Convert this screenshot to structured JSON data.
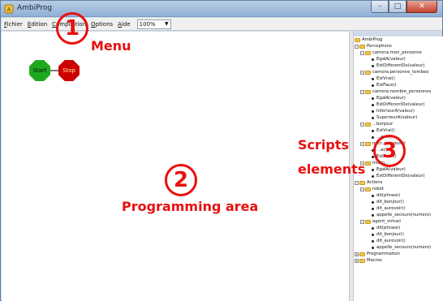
{
  "window": {
    "title": "AmbiProg",
    "minimize_glyph": "–",
    "maximize_glyph": "□",
    "close_glyph": "✕"
  },
  "menubar": {
    "items": [
      {
        "label": "Fichier",
        "underline": "F",
        "rest": "ichier"
      },
      {
        "label": "Edition",
        "underline": "E",
        "rest": "dition"
      },
      {
        "label": "Compilation",
        "underline": "C",
        "rest": "ompilation"
      },
      {
        "label": "Options",
        "underline": "O",
        "rest": "ptions"
      },
      {
        "label": "Aide",
        "underline": "A",
        "rest": "ide"
      }
    ],
    "zoom_value": "100%"
  },
  "program_area": {
    "start_label": "Start",
    "stop_label": "Stop"
  },
  "tree": {
    "root": "AmbiProg",
    "perceptions": "Perceptions",
    "camera_mon_personne": "camera.mon_personne",
    "egala_valeur_1": "EgalA(valeur)",
    "estdifferentde_valeur_1": "EstDifferentDe(valeur)",
    "camera_personne_tombee": "camera.personne_tombee",
    "estvrai_1": "EstVrai()",
    "estfaux_1": "EstFaux()",
    "camera_nombre_personnes": "camera.nombre_personnes",
    "egala_valeur_2": "EgalA(valeur)",
    "estdifferentde_valeur_2": "EstDifferentDe(valeur)",
    "inferieura_valeur": "InferieurA(valeur)",
    "superieura_valeur": "SuperieurA(valeur)",
    "micro_bonjour_partial": "...bonjour",
    "estvrai_2": "EstVrai()",
    "estfaux_2_partial": "...aux()",
    "micro_au_revoir_partial": "micr...au_revoir",
    "estvrai_3_partial": "...ai()",
    "estfaux_3": "EstFaux()",
    "microphone_partial": "micro...",
    "egala_valeur_3": "EgalA(valeur)",
    "estdifferentde_valeur_3": "EstDifferentDe(valeur)",
    "actions": "Actions",
    "robot": "robot",
    "dit_phrase_1": "dit(phrase)",
    "dit_bonjour_1": "dit_bonjour()",
    "dit_aurevoir_1": "dit_aurevoir()",
    "appelle_secours_1": "appelle_secours(numero)",
    "agent_virtuel": "agent_virtuel",
    "dit_phrase_2": "dit(phrase)",
    "dit_bonjour_2": "dit_bonjour()",
    "dit_aurevoir_2": "dit_aurevoir()",
    "appelle_secours_2": "appelle_secours(numero)",
    "programmation": "Programmation",
    "macros": "Macros"
  },
  "annotations": {
    "num_1": "1",
    "label_1": "Menu",
    "num_2": "2",
    "label_2": "Programming area",
    "num_3": "3",
    "label_3_line1": "Scripts",
    "label_3_line2": "elements"
  },
  "colors": {
    "annotation_red": "#e81010",
    "start_green": "#1ea81e",
    "stop_red": "#cc0000"
  }
}
